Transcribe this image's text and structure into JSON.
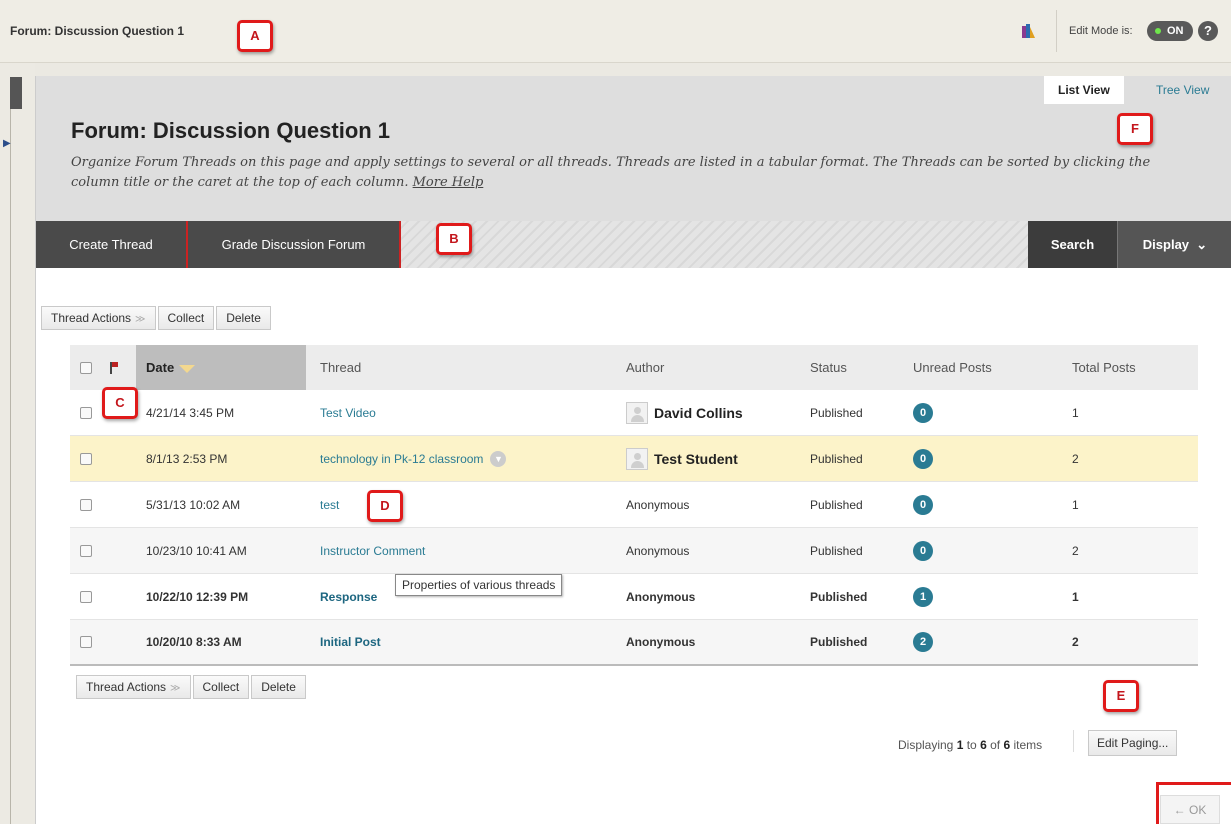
{
  "topbar": {
    "breadcrumb": "Forum: Discussion Question 1",
    "edit_mode_label": "Edit Mode is:",
    "edit_mode_state": "ON",
    "help_label": "?"
  },
  "views": {
    "list": "List View",
    "tree": "Tree View"
  },
  "page": {
    "title": "Forum: Discussion Question 1",
    "description": "Organize Forum Threads on this page and apply settings to several or all threads. Threads are listed in a tabular format. The Threads can be sorted by clicking the column title or the caret at the top of each column.",
    "more_help": "More Help"
  },
  "action_bar": {
    "create_thread": "Create Thread",
    "grade_forum": "Grade Discussion Forum",
    "search": "Search",
    "display": "Display"
  },
  "tools": {
    "thread_actions": "Thread Actions",
    "collect": "Collect",
    "delete": "Delete"
  },
  "table": {
    "headers": {
      "date": "Date",
      "thread": "Thread",
      "author": "Author",
      "status": "Status",
      "unread": "Unread Posts",
      "total": "Total Posts"
    },
    "rows": [
      {
        "date": "4/21/14 3:45 PM",
        "thread": "Test Video",
        "author": "David Collins",
        "status": "Published",
        "unread": "0",
        "total": "1"
      },
      {
        "date": "8/1/13 2:53 PM",
        "thread": "technology in Pk-12 classroom",
        "author": "Test Student",
        "status": "Published",
        "unread": "0",
        "total": "2"
      },
      {
        "date": "5/31/13 10:02 AM",
        "thread": "test",
        "author": "Anonymous",
        "status": "Published",
        "unread": "0",
        "total": "1"
      },
      {
        "date": "10/23/10 10:41 AM",
        "thread": "Instructor Comment",
        "author": "Anonymous",
        "status": "Published",
        "unread": "0",
        "total": "2"
      },
      {
        "date": "10/22/10 12:39 PM",
        "thread": "Response",
        "author": "Anonymous",
        "status": "Published",
        "unread": "1",
        "total": "1"
      },
      {
        "date": "10/20/10 8:33 AM",
        "thread": "Initial Post",
        "author": "Anonymous",
        "status": "Published",
        "unread": "2",
        "total": "2"
      }
    ]
  },
  "tooltip": "Properties of various threads",
  "paging": {
    "prefix": "Displaying ",
    "from": "1",
    "to_word": " to ",
    "to": "6",
    "of_word": " of ",
    "total": "6",
    "suffix": " items",
    "edit": "Edit Paging..."
  },
  "ok": "← OK",
  "markers": {
    "a": "A",
    "b": "B",
    "c": "C",
    "d": "D",
    "e": "E",
    "f": "F"
  },
  "colors": {
    "accent": "#2a7b93",
    "highlight_row": "#fcf3c9",
    "marker": "#e01a1a"
  }
}
